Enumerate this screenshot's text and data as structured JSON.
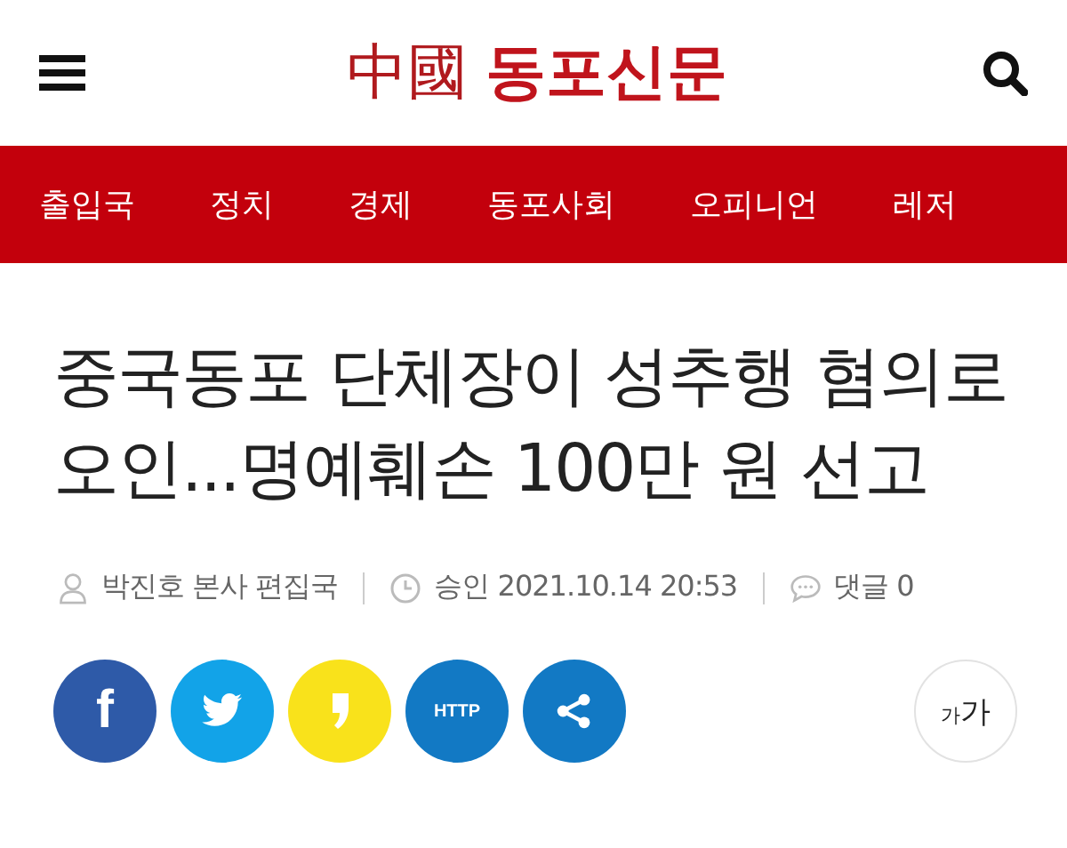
{
  "header": {
    "logo_hanja": "中國",
    "logo_hangul": "동포신문"
  },
  "nav": [
    {
      "label": "출입국"
    },
    {
      "label": "정치"
    },
    {
      "label": "경제"
    },
    {
      "label": "동포사회"
    },
    {
      "label": "오피니언"
    },
    {
      "label": "레저"
    }
  ],
  "article": {
    "title": "중국동포 단체장이 성추행 혐의로 오인...명예훼손 100만 원 선고",
    "author": "박진호 본사 편집국",
    "approved": "승인 2021.10.14 20:53",
    "comments": "댓글 0"
  },
  "share": [
    {
      "kind": "facebook",
      "label": "f",
      "color": "#2e5aa8"
    },
    {
      "kind": "twitter",
      "color": "#12a3e8"
    },
    {
      "kind": "kakaostory",
      "color": "#f9e21b"
    },
    {
      "kind": "url",
      "label": "HTTP",
      "color": "#1279c4"
    },
    {
      "kind": "share",
      "color": "#1279c4"
    }
  ],
  "font_size_button": {
    "small": "가",
    "large": "가"
  }
}
